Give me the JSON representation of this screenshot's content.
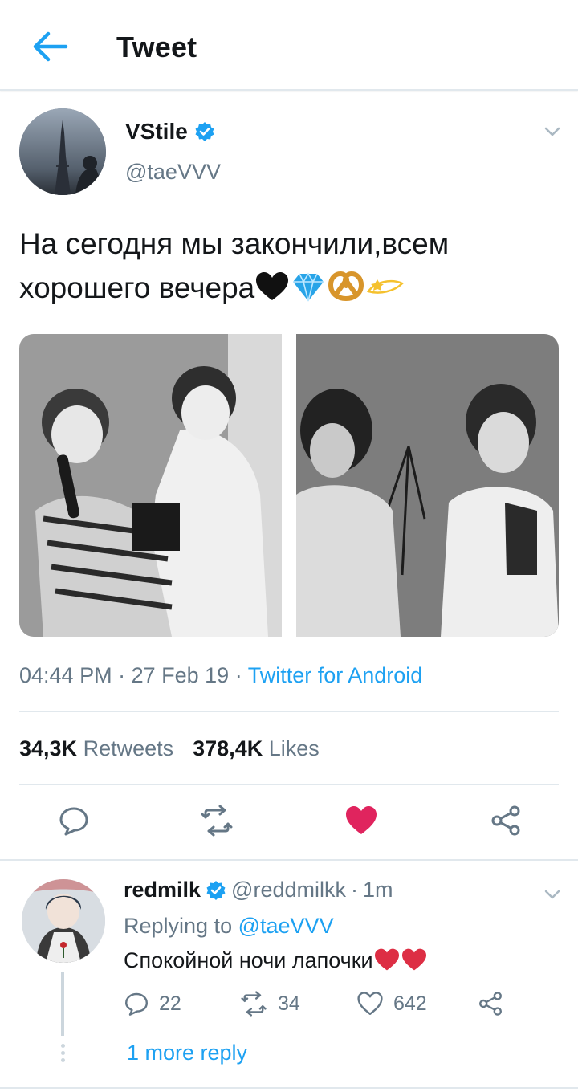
{
  "header": {
    "title": "Tweet",
    "back_icon": "arrow-left-icon"
  },
  "tweet": {
    "author_name": "VStile",
    "author_handle": "@taeVVV",
    "verified": true,
    "text": "На сегодня мы закончили,всем хорошего вечера",
    "emojis": [
      "black-heart",
      "gem",
      "pretzel",
      "dizzy-star"
    ],
    "time": "04:44 PM",
    "date": "27 Feb 19",
    "source": "Twitter for Android",
    "retweets_count": "34,3K",
    "retweets_label": "Retweets",
    "likes_count": "378,4K",
    "likes_label": "Likes",
    "liked": true
  },
  "reply": {
    "author_name": "redmilk",
    "author_handle": "@reddmilkk",
    "age": "1m",
    "verified": true,
    "replying_label": "Replying to",
    "replying_to": "@taeVVV",
    "text": "Спокойной ночи лапочки",
    "emojis": [
      "red-heart",
      "red-heart"
    ],
    "replies": "22",
    "retweets": "34",
    "likes": "642"
  },
  "more_replies": "1 more reply",
  "colors": {
    "accent": "#1da1f2",
    "like": "#e0245e",
    "text": "#14171a",
    "muted": "#657786",
    "divider": "#e1e8ed"
  }
}
